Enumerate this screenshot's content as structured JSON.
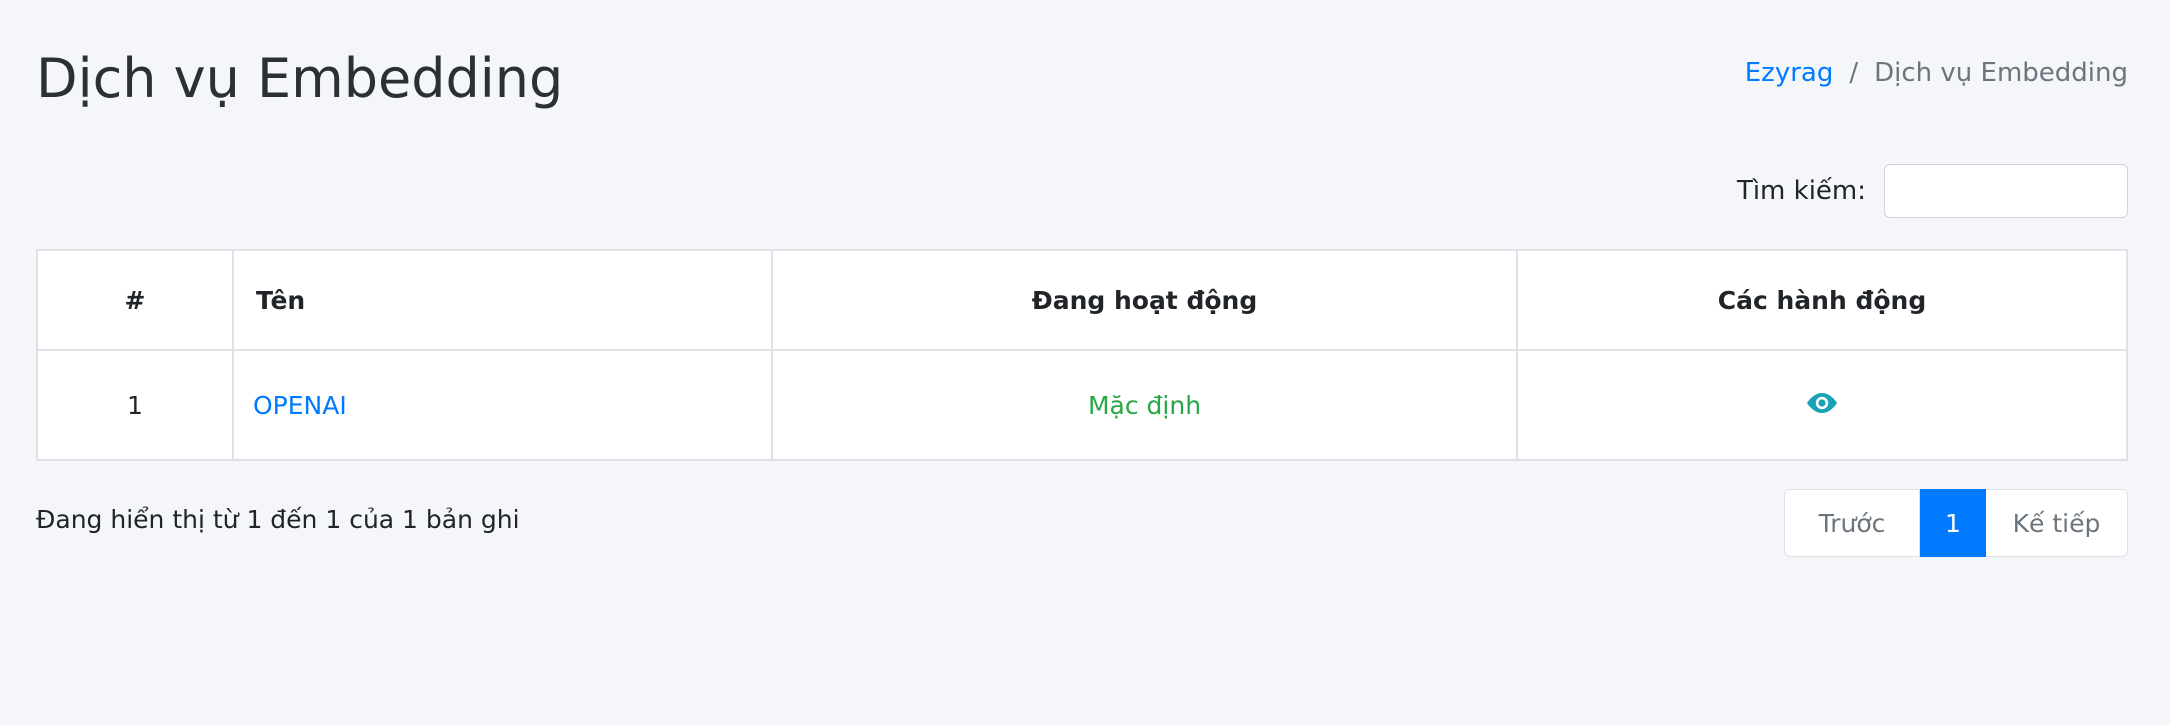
{
  "header": {
    "title": "Dịch vụ Embedding",
    "breadcrumb": {
      "home": "Ezyrag",
      "separator": "/",
      "current": "Dịch vụ Embedding"
    }
  },
  "search": {
    "label": "Tìm kiếm:",
    "value": "",
    "placeholder": ""
  },
  "table": {
    "columns": [
      "#",
      "Tên",
      "Đang hoạt động",
      "Các hành động"
    ],
    "rows": [
      {
        "num": "1",
        "name": "OPENAI",
        "status": "Mặc định",
        "action_icon": "eye-icon"
      }
    ]
  },
  "footer": {
    "info": "Đang hiển thị từ 1 đến 1 của 1 bản ghi",
    "pagination": {
      "prev": "Trước",
      "current": "1",
      "next": "Kế tiếp"
    }
  },
  "colors": {
    "background": "#f4f6f9",
    "link": "#007bff",
    "status": "#28a745",
    "icon": "#17a2b8",
    "active_page": "#007bff"
  }
}
